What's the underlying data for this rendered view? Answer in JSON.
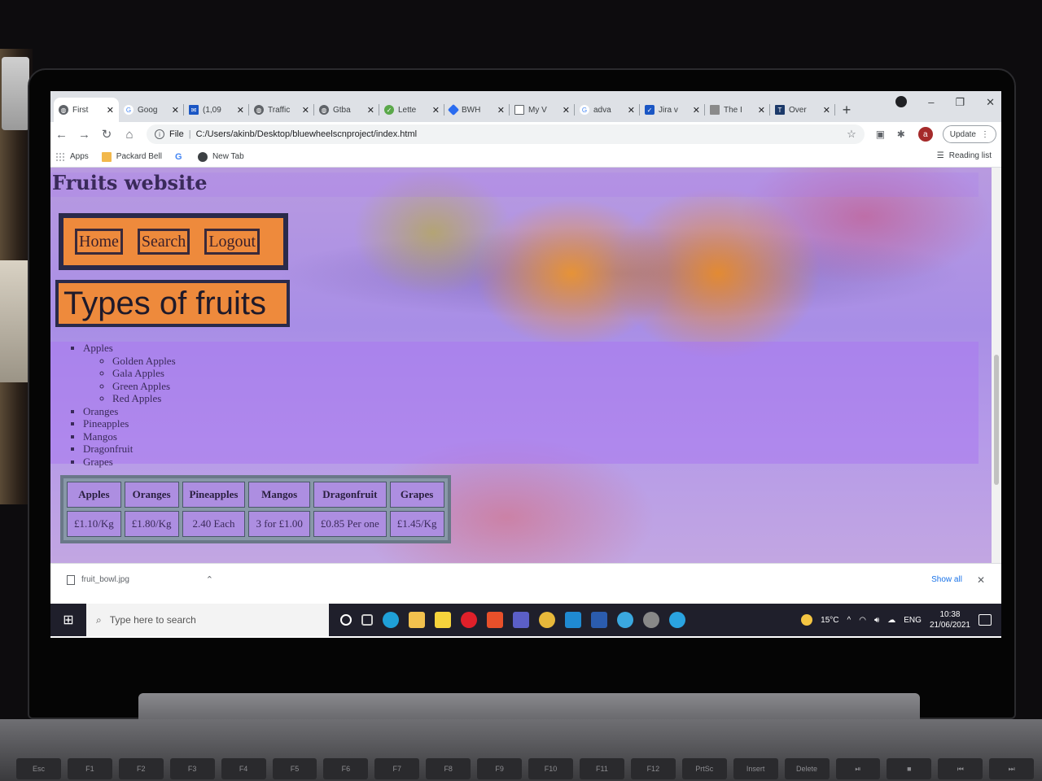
{
  "browser": {
    "tabs": [
      {
        "title": "First",
        "active": true
      },
      {
        "title": "Goog",
        "active": false
      },
      {
        "title": "(1,09",
        "active": false
      },
      {
        "title": "Traffic",
        "active": false
      },
      {
        "title": "Gtba",
        "active": false
      },
      {
        "title": "Lette",
        "active": false
      },
      {
        "title": "BWH",
        "active": false
      },
      {
        "title": "My V",
        "active": false
      },
      {
        "title": "adva",
        "active": false
      },
      {
        "title": "Jira v",
        "active": false
      },
      {
        "title": "The I",
        "active": false
      },
      {
        "title": "Over",
        "active": false
      }
    ],
    "omnibox": {
      "scheme_label": "File",
      "url": "C:/Users/akinb/Desktop/bluewheelscnproject/index.html"
    },
    "update_label": "Update",
    "avatar_letter": "a",
    "bookmarks": [
      {
        "label": "Apps",
        "icon": "apps-icon"
      },
      {
        "label": "Packard Bell",
        "icon": "folder-icon"
      },
      {
        "label": "",
        "icon": "google-icon"
      },
      {
        "label": "New Tab",
        "icon": "globe-icon"
      }
    ],
    "reading_list_label": "Reading list"
  },
  "page": {
    "site_title": "Fruits website",
    "nav": {
      "home": "Home",
      "search": "Search",
      "logout": "Logout"
    },
    "heading": "Types of fruits",
    "list": {
      "apples": "Apples",
      "apple_varieties": [
        "Golden Apples",
        "Gala Apples",
        "Green Apples",
        "Red Apples"
      ],
      "others": [
        "Oranges",
        "Pineapples",
        "Mangos",
        "Dragonfruit",
        "Grapes"
      ]
    },
    "table": {
      "headers": [
        "Apples",
        "Oranges",
        "Pineapples",
        "Mangos",
        "Dragonfruit",
        "Grapes"
      ],
      "prices": [
        "£1.10/Kg",
        "£1.80/Kg",
        "2.40 Each",
        "3 for £1.00",
        "£0.85 Per one",
        "£1.45/Kg"
      ]
    },
    "colors": {
      "nav_background": "#ee8a3c",
      "page_tint": "#b89ae0"
    }
  },
  "downloads": {
    "file_name": "fruit_bowl.jpg",
    "show_all": "Show all"
  },
  "taskbar": {
    "search_placeholder": "Type here to search",
    "temperature": "15°C",
    "language": "ENG",
    "time": "10:38",
    "date": "21/06/2021"
  },
  "keyboard": [
    "Esc",
    "F1",
    "F2",
    "F3",
    "F4",
    "F5",
    "F6",
    "F7",
    "F8",
    "F9",
    "F10",
    "F11",
    "F12",
    "PrtSc",
    "Insert",
    "Delete",
    "⏯",
    "■",
    "⏮",
    "⏭"
  ]
}
